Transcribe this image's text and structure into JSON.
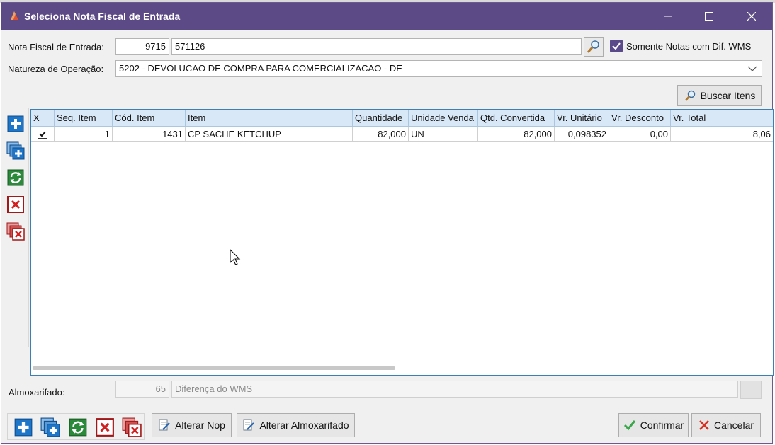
{
  "window": {
    "title": "Seleciona Nota Fiscal de Entrada"
  },
  "titlebar_icons": [
    "app-icon",
    "minimize-icon",
    "maximize-icon",
    "close-icon"
  ],
  "form": {
    "nota_label": "Nota Fiscal de Entrada:",
    "nota_serie": "9715",
    "nota_numero": "571126",
    "somente_label": "Somente Notas com Dif. WMS",
    "somente_checked": true,
    "natureza_label": "Natureza de Operação:",
    "natureza_value": "5202 - DEVOLUCAO DE  COMPRA PARA COMERCIALIZACAO - DE",
    "buscar_label": "Buscar Itens"
  },
  "grid": {
    "columns": [
      "X",
      "Seq. Item",
      "Cód. Item",
      "Item",
      "Quantidade",
      "Unidade Venda",
      "Qtd. Convertida",
      "Vr. Unitário",
      "Vr. Desconto",
      "Vr. Total"
    ],
    "rows": [
      {
        "checked": true,
        "seq": "1",
        "cod": "1431",
        "item": "CP SACHE KETCHUP",
        "quantidade": "82,000",
        "unidade": "UN",
        "qtd_convertida": "82,000",
        "vr_unitario": "0,098352",
        "vr_desconto": "0,00",
        "vr_total": "8,06"
      }
    ]
  },
  "side_toolbar": [
    "add-icon",
    "add-multiple-icon",
    "refresh-icon",
    "delete-icon",
    "delete-multiple-icon"
  ],
  "footer": {
    "almox_label": "Almoxarifado:",
    "almox_code": "65",
    "almox_desc": "Diferença do WMS",
    "alterar_nop": "Alterar Nop",
    "alterar_almox": "Alterar Almoxarifado",
    "confirmar": "Confirmar",
    "cancelar": "Cancelar"
  },
  "colors": {
    "titlebar": "#5c4a86",
    "grid_border": "#3c7fb1",
    "grid_header": "#d9e8f7"
  }
}
